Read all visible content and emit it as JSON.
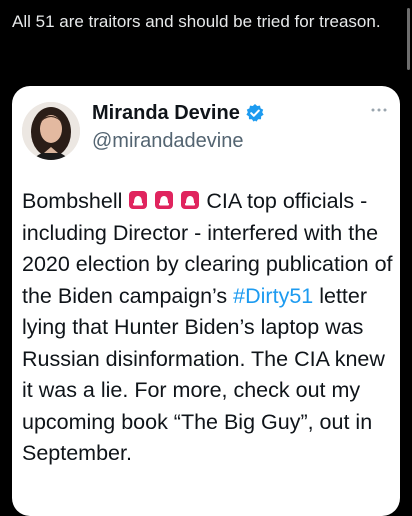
{
  "post": {
    "text": "All 51 are traitors and should be tried for treason."
  },
  "quoted_tweet": {
    "author_name": "Miranda Devine",
    "handle": "@mirandadevine",
    "body_part1": "Bombshell ",
    "body_part2": "CIA top officials - including Director - interfered with the 2020 election by clearing publication of the Biden campaign’s ",
    "hashtag": "#Dirty51",
    "body_part3": " letter lying that Hunter Biden’s laptop was Russian disinformation. The CIA knew it was a lie. For more, check out my upcoming book “The Big Guy”, out in September.",
    "emoji_icons": [
      "siren-icon",
      "siren-icon",
      "siren-icon"
    ],
    "verified_icon": "verified-badge-icon",
    "more_icon": "more-options-icon"
  },
  "colors": {
    "background": "#000000",
    "card": "#ffffff",
    "text_dark": "#0f1419",
    "handle_gray": "#536471",
    "link_blue": "#1d9bf0",
    "verified_blue": "#1d9bf0",
    "siren_red": "#e0245e"
  }
}
